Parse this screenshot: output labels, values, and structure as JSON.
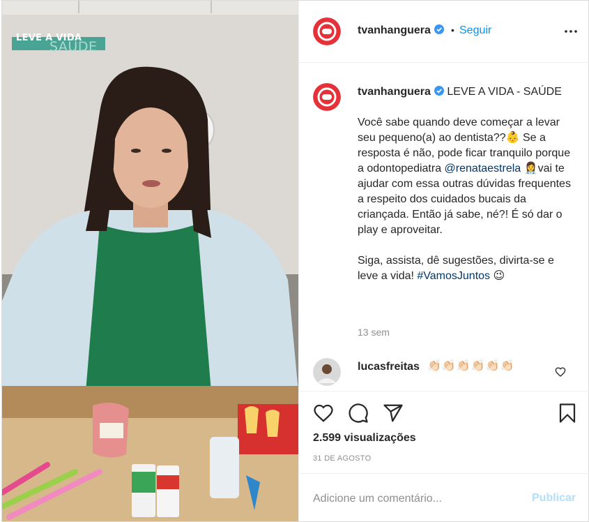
{
  "media": {
    "overlay_line1": "LEVE A VIDA",
    "overlay_line2": "SAÚDE",
    "accent": "#2f9a8a"
  },
  "header": {
    "username": "tvanhanguera",
    "separator": "•",
    "follow_label": "Seguir",
    "avatar_icon": "tvanhanguera-logo",
    "more_icon": "more-options-icon"
  },
  "caption": {
    "username": "tvanhanguera",
    "title": "LEVE A VIDA - SAÚDE",
    "p1_a": "Você sabe quando deve começar a levar seu pequeno(a) ao dentista??",
    "p1_emoji": "👶",
    "p1_b": " Se a resposta é não, pode ficar tranquilo porque a odontopediatra ",
    "p1_mention": "@renataestrela",
    "p1_emoji2": "👩‍⚕️",
    "p1_c": "vai te ajudar com essa outras dúvidas frequentes a respeito dos cuidados bucais da criançada. Então já sabe, né?! É só dar o play e aproveitar.",
    "p2_a": "Siga, assista, dê sugestões, divirta-se e leve a vida! ",
    "p2_hashtag": "#VamosJuntos",
    "p2_emoji": "😉",
    "time": "13 sem"
  },
  "comment": {
    "username": "lucasfreitas",
    "text": "👏🏻👏🏻👏🏻👏🏻👏🏻👏🏻"
  },
  "actions": {
    "views": "2.599 visualizações",
    "date": "31 DE AGOSTO"
  },
  "add_comment": {
    "placeholder": "Adicione um comentário...",
    "publish_label": "Publicar"
  },
  "colors": {
    "brand_blue": "#0095f6",
    "brand_red": "#e0303a",
    "muted": "#8e8e8e",
    "publish_disabled": "#b2dffc"
  }
}
